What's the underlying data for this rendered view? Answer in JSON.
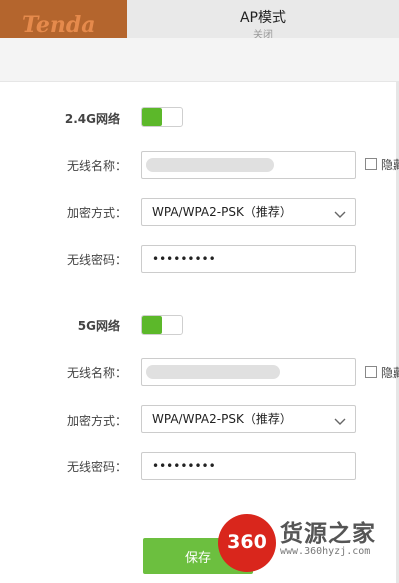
{
  "header": {
    "logo_text": "Tenda",
    "title": "AP模式",
    "status": "关闭"
  },
  "band_24g": {
    "label": "2.4G网络",
    "enabled": true,
    "ssid_label": "无线名称：",
    "hide_label": "隐藏",
    "security_label": "加密方式：",
    "security_value": "WPA/WPA2-PSK（推荐）",
    "password_label": "无线密码：",
    "password_value": "•••••••••"
  },
  "band_5g": {
    "label": "5G网络",
    "enabled": true,
    "ssid_label": "无线名称：",
    "hide_label": "隐藏",
    "security_label": "加密方式：",
    "security_value": "WPA/WPA2-PSK（推荐）",
    "password_label": "无线密码：",
    "password_value": "•••••••••"
  },
  "actions": {
    "save_label": "保存"
  },
  "watermark": {
    "badge": "360",
    "site_name": "货源之家",
    "url": "www.360hyzj.com"
  },
  "colors": {
    "accent_green": "#5cb82a",
    "button_green": "#6cbf3f",
    "logo_bg": "#b4652d",
    "watermark_red": "#d9261c"
  }
}
